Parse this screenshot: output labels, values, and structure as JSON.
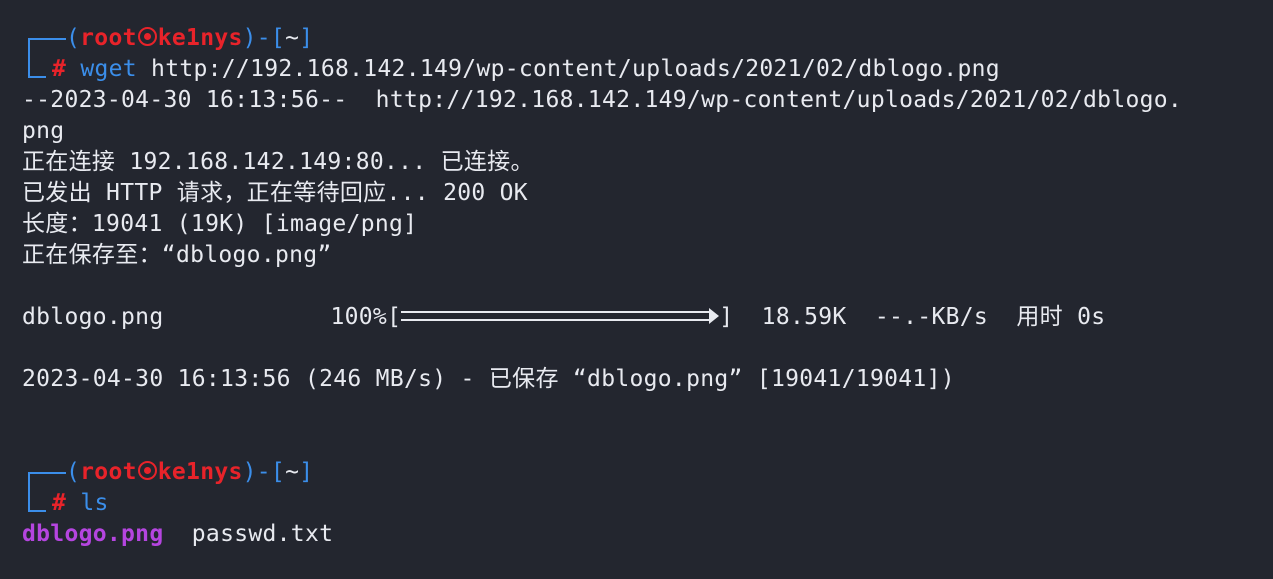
{
  "prompt1": {
    "open": "(",
    "user": "root",
    "host": "ke1nys",
    "close_dir_open": ")-[",
    "dir": "~",
    "close": "]",
    "hash": "#",
    "cmd_name": "wget",
    "cmd_args": " http://192.168.142.149/wp-content/uploads/2021/02/dblogo.png"
  },
  "output": {
    "line1": "--2023-04-30 16:13:56--  http://192.168.142.149/wp-content/uploads/2021/02/dblogo.",
    "line2": "png",
    "line3": "正在连接 192.168.142.149:80... 已连接。",
    "line4": "已发出 HTTP 请求，正在等待回应... 200 OK",
    "line5": "长度：19041 (19K) [image/png]",
    "line6": "正在保存至：“dblogo.png”",
    "progress_file": "dblogo.png",
    "progress_pct": "100%[",
    "progress_value": 1.0,
    "progress_end": "]",
    "progress_stats": "  18.59K  --.-KB/s  用时 0s",
    "saved": "2023-04-30 16:13:56 (246 MB/s) - 已保存 “dblogo.png” [19041/19041])"
  },
  "prompt2": {
    "open": "(",
    "user": "root",
    "host": "ke1nys",
    "close_dir_open": ")-[",
    "dir": "~",
    "close": "]",
    "hash": "#",
    "cmd_name": "ls"
  },
  "ls_output": {
    "file1": "dblogo.png",
    "file2": "passwd.txt"
  },
  "colors": {
    "background": "#23262f",
    "prompt_blue": "#3b8eea",
    "user_red": "#e8232a",
    "image_file_purple": "#b545e0",
    "text": "#e8eaf0"
  }
}
